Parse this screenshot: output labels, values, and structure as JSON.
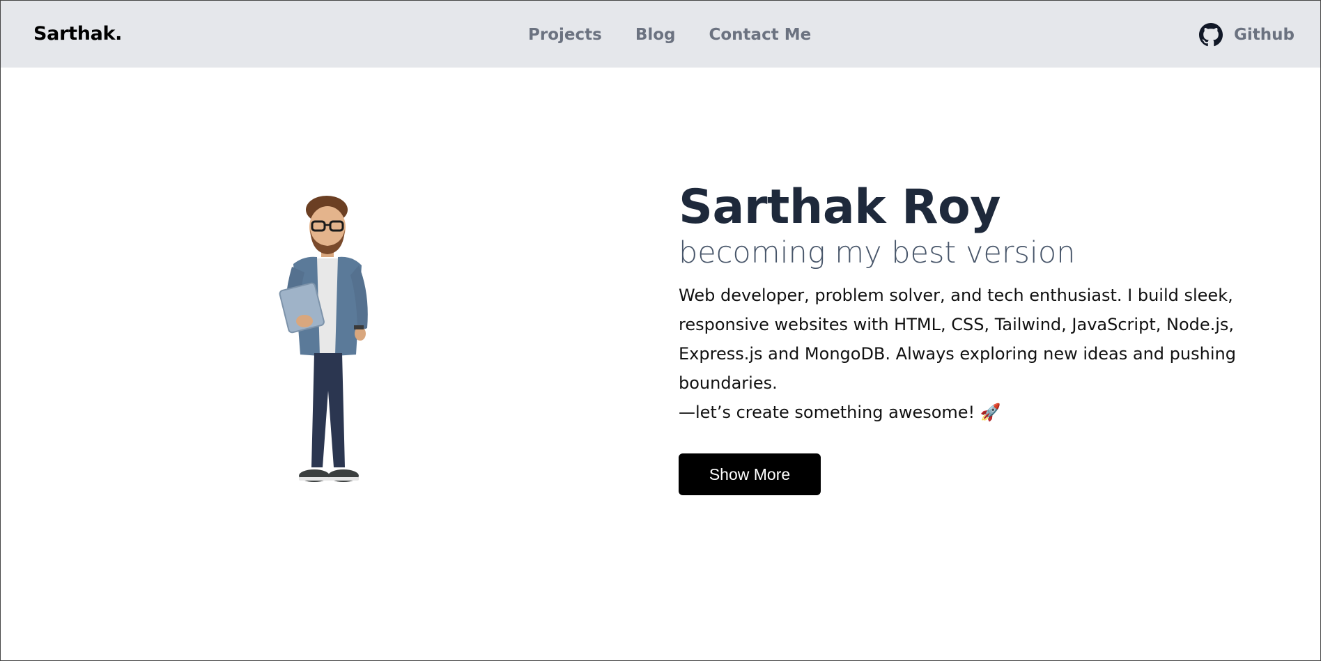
{
  "nav": {
    "brand": "Sarthak.",
    "links": [
      "Projects",
      "Blog",
      "Contact Me"
    ],
    "github_label": "Github",
    "github_icon": "github-icon"
  },
  "hero": {
    "avatar_icon": "avatar-illustration",
    "name": "Sarthak Roy",
    "tagline": "becoming my best version",
    "description": "Web developer, problem solver, and tech enthusiast. I build sleek, responsive websites with HTML, CSS, Tailwind, JavaScript, Node.js, Express.js and MongoDB. Always exploring new ideas and pushing boundaries.",
    "closing": "—let’s create something awesome! 🚀",
    "button_label": "Show More"
  },
  "colors": {
    "navbar_bg": "#e5e7eb",
    "nav_text": "#6b7280",
    "heading": "#1e293b",
    "tagline": "#475569",
    "button_bg": "#000000",
    "button_text": "#ffffff"
  }
}
